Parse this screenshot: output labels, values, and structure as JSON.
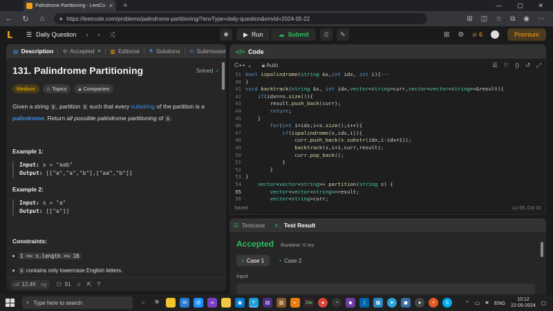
{
  "browser": {
    "tab_title": "Palindrome Partitioning - LeetCo",
    "url": "https://leetcode.com/problems/palindrome-partitioning/?envType=daily-question&envId=2024-05-22"
  },
  "topbar": {
    "daily_label": "Daily Question",
    "run_label": "Run",
    "submit_label": "Submit",
    "streak_count": "6",
    "premium_label": "Premium"
  },
  "left_tabs": [
    {
      "label": "Description"
    },
    {
      "label": "Accepted"
    },
    {
      "label": "Editorial"
    },
    {
      "label": "Solutions"
    },
    {
      "label": "Submissions"
    }
  ],
  "problem": {
    "title": "131. Palindrome Partitioning",
    "solved_label": "Solved",
    "difficulty": "Medium",
    "topics_label": "Topics",
    "companies_label": "Companies",
    "stmt_1": "Given a string ",
    "stmt_s1": "s",
    "stmt_2": ", partition ",
    "stmt_s2": "s",
    "stmt_3": " such that every ",
    "stmt_link1": "substring",
    "stmt_4": " of the partition is a ",
    "stmt_link2": "palindrome",
    "stmt_5": ". Return ",
    "stmt_em": "all possible palindrome partitioning",
    "stmt_6": " of ",
    "stmt_s3": "s",
    "stmt_7": ".",
    "ex1_heading": "Example 1:",
    "ex1_input_label": "Input:",
    "ex1_input": "s = \"aab\"",
    "ex1_output_label": "Output:",
    "ex1_output": "[[\"a\",\"a\",\"b\"],[\"aa\",\"b\"]]",
    "ex2_heading": "Example 2:",
    "ex2_input_label": "Input:",
    "ex2_input": "s = \"a\"",
    "ex2_output_label": "Output:",
    "ex2_output": "[[\"a\"]]",
    "constraints_heading": "Constraints:",
    "constraint_1": "1 <= s.length <= 16",
    "constraint_2_code": "s",
    "constraint_2_text": " contains only lowercase English letters."
  },
  "left_footer": {
    "likes": "12.4K",
    "comments": "91"
  },
  "code_panel": {
    "title": "Code",
    "language": "C++",
    "mode": "Auto",
    "status": "Saved",
    "cursor": "Ln 55, Col 31",
    "lines": [
      {
        "n": "31",
        "text": "bool ispalindrome(string &s,int idx, int i){···"
      },
      {
        "n": "40",
        "text": "}"
      },
      {
        "n": "41",
        "text": "void backtrack(string &s, int idx,vector<string>curr,vector<vector<string>>&result){"
      },
      {
        "n": "42",
        "text": "    if(idx==s.size()){"
      },
      {
        "n": "43",
        "text": "        result.push_back(curr);"
      },
      {
        "n": "44",
        "text": "        return;"
      },
      {
        "n": "45",
        "text": "    }"
      },
      {
        "n": "46",
        "text": "        for(int i=idx;i<s.size();i++){"
      },
      {
        "n": "47",
        "text": "            if(ispalindrome(s,idx,i)){"
      },
      {
        "n": "48",
        "text": "                curr.push_back(s.substr(idx,i-idx+1));"
      },
      {
        "n": "49",
        "text": "                backtrack(s,i+1,curr,result);"
      },
      {
        "n": "50",
        "text": "                curr.pop_back();"
      },
      {
        "n": "51",
        "text": "            }"
      },
      {
        "n": "52",
        "text": "        }"
      },
      {
        "n": "53",
        "text": "}"
      },
      {
        "n": "54",
        "text": "    vector<vector<string>> partition(string s) {"
      },
      {
        "n": "55",
        "text": "        vector<vector<string>>result;"
      },
      {
        "n": "56",
        "text": "        vector<string>curr;"
      }
    ]
  },
  "test_panel": {
    "testcase_tab": "Testcase",
    "result_tab": "Test Result",
    "verdict": "Accepted",
    "runtime": "Runtime: 0 ms",
    "case1": "Case 1",
    "case2": "Case 2",
    "input_label": "Input"
  },
  "taskbar": {
    "search_placeholder": "Type here to search",
    "lang": "ENG",
    "time": "10:12",
    "date": "22-05-2024"
  }
}
